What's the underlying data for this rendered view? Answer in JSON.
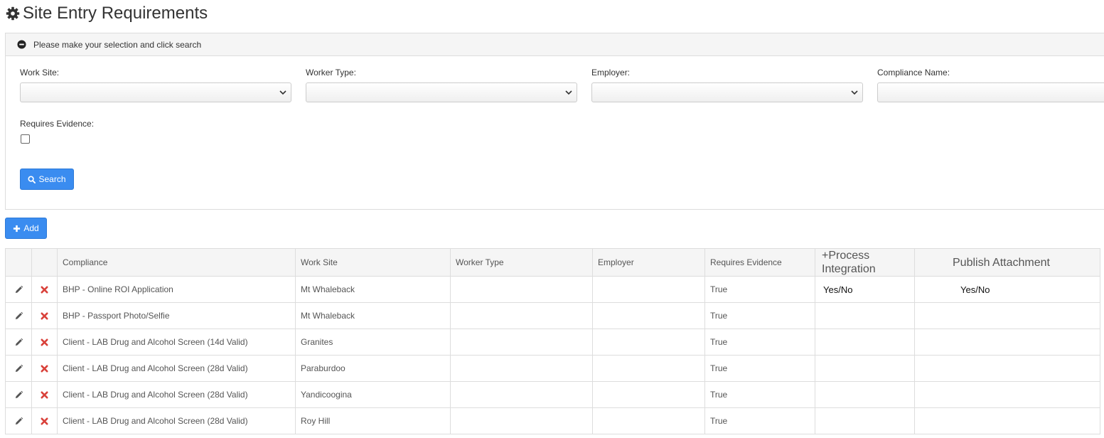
{
  "page": {
    "title": "Site Entry Requirements",
    "title_icon": "gear-icon"
  },
  "search_panel": {
    "header": "Please make your selection and click search",
    "collapse_icon": "minus-circle-icon",
    "fields": {
      "work_site": {
        "label": "Work Site:",
        "value": ""
      },
      "worker_type": {
        "label": "Worker Type:",
        "value": ""
      },
      "employer": {
        "label": "Employer:",
        "value": ""
      },
      "compliance_name": {
        "label": "Compliance Name:",
        "value": ""
      },
      "requires_evidence": {
        "label": "Requires Evidence:",
        "checked": false
      }
    },
    "search_button": "Search"
  },
  "add_button": "Add",
  "table": {
    "columns": {
      "compliance": "Compliance",
      "work_site": "Work Site",
      "worker_type": "Worker Type",
      "employer": "Employer",
      "requires_evidence": "Requires Evidence",
      "process_integration": "+Process Integration",
      "publish_attachment": "Publish Attachment"
    },
    "rows": [
      {
        "compliance": "BHP - Online ROI Application",
        "work_site": "Mt Whaleback",
        "worker_type": "",
        "employer": "",
        "requires_evidence": "True",
        "process_integration": "Yes/No",
        "publish_attachment": "Yes/No"
      },
      {
        "compliance": "BHP - Passport Photo/Selfie",
        "work_site": "Mt Whaleback",
        "worker_type": "",
        "employer": "",
        "requires_evidence": "True",
        "process_integration": "",
        "publish_attachment": ""
      },
      {
        "compliance": "Client - LAB Drug and Alcohol Screen (14d Valid)",
        "work_site": "Granites",
        "worker_type": "",
        "employer": "",
        "requires_evidence": "True",
        "process_integration": "",
        "publish_attachment": ""
      },
      {
        "compliance": "Client - LAB Drug and Alcohol Screen (28d Valid)",
        "work_site": "Paraburdoo",
        "worker_type": "",
        "employer": "",
        "requires_evidence": "True",
        "process_integration": "",
        "publish_attachment": ""
      },
      {
        "compliance": "Client - LAB Drug and Alcohol Screen (28d Valid)",
        "work_site": "Yandicoogina",
        "worker_type": "",
        "employer": "",
        "requires_evidence": "True",
        "process_integration": "",
        "publish_attachment": ""
      },
      {
        "compliance": "Client - LAB Drug and Alcohol Screen (28d Valid)",
        "work_site": "Roy Hill",
        "worker_type": "",
        "employer": "",
        "requires_evidence": "True",
        "process_integration": "",
        "publish_attachment": ""
      }
    ]
  },
  "colors": {
    "primary": "#3a8cf0",
    "delete": "#d9413a",
    "annotation": "#e0202a"
  }
}
